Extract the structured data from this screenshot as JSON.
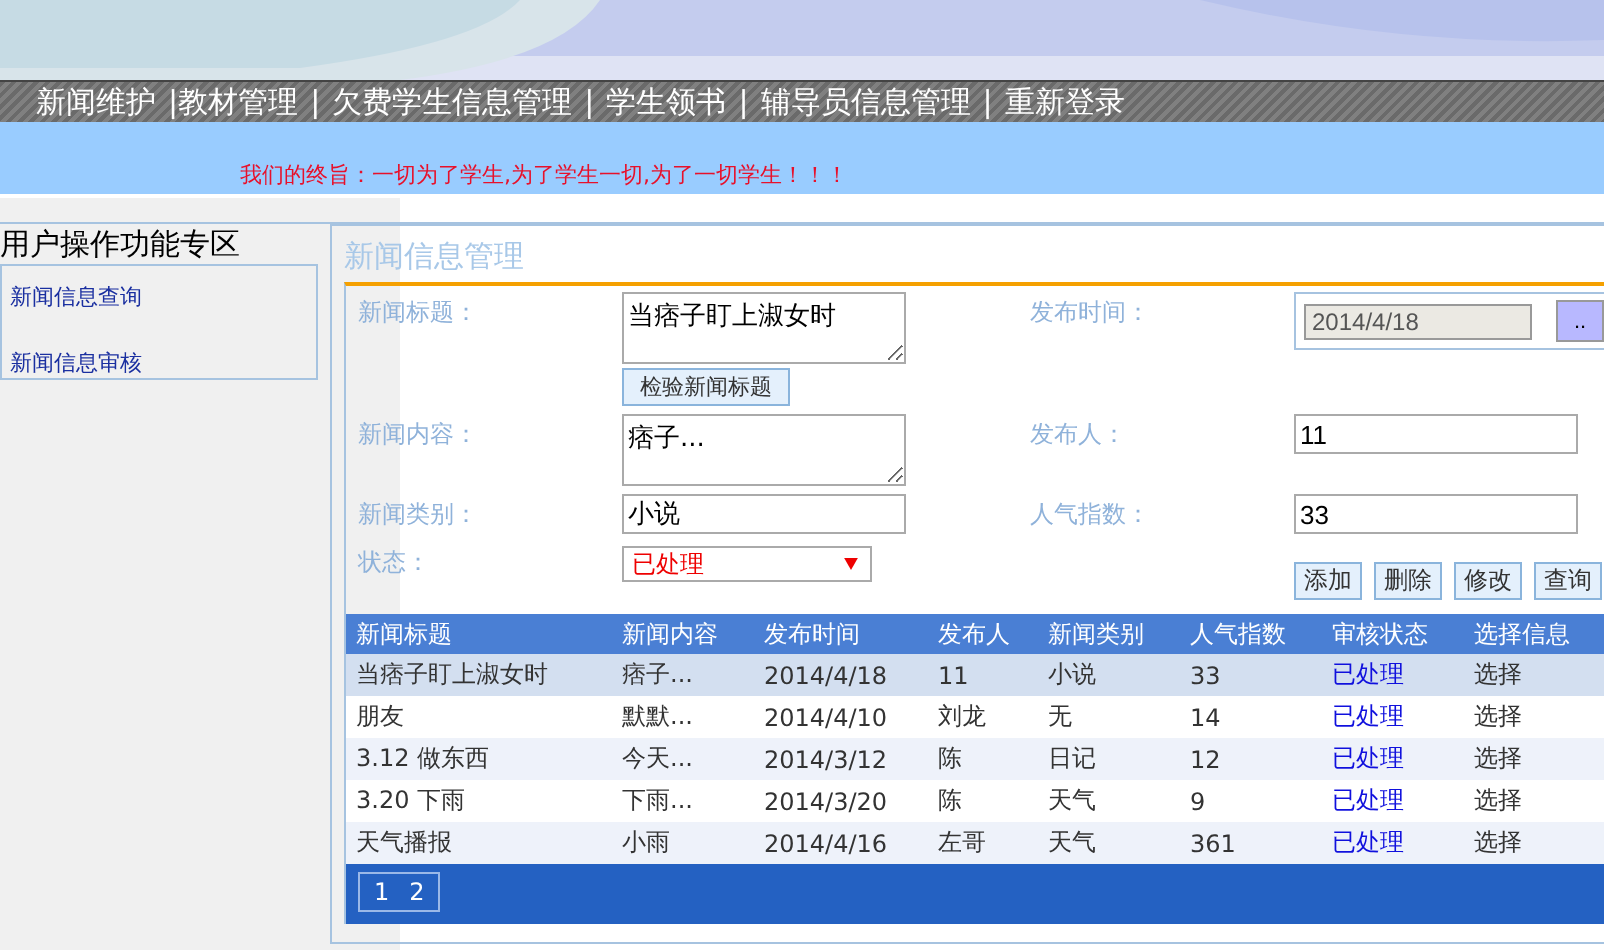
{
  "nav": [
    "新闻维护",
    "|教材管理",
    "|",
    "欠费学生信息管理",
    "|",
    "学生领书",
    "|",
    "辅导员信息管理",
    "|",
    "重新登录"
  ],
  "slogan": "我们的终旨：一切为了学生,为了学生一切,为了一切学生！！！",
  "sidebar": {
    "title": "用户操作功能专区",
    "items": [
      "新闻信息查询",
      "新闻信息审核"
    ]
  },
  "panel_title": "新闻信息管理",
  "form": {
    "title_label": "新闻标题：",
    "title_value": "当痞子盯上淑女时",
    "check_button": "检验新闻标题",
    "time_label": "发布时间：",
    "time_value": "2014/4/18",
    "time_button": "..",
    "content_label": "新闻内容：",
    "content_value": "痞子...",
    "author_label": "发布人：",
    "author_value": "11",
    "category_label": "新闻类别：",
    "category_value": "小说",
    "popularity_label": "人气指数：",
    "popularity_value": "33",
    "status_label": "状态：",
    "status_value": "已处理"
  },
  "actions": [
    "添加",
    "删除",
    "修改",
    "查询"
  ],
  "table": {
    "columns": [
      "新闻标题",
      "新闻内容",
      "发布时间",
      "发布人",
      "新闻类别",
      "人气指数",
      "审核状态",
      "选择信息"
    ],
    "rows": [
      {
        "cells": [
          "当痞子盯上淑女时",
          "痞子...",
          "2014/4/18",
          "11",
          "小说",
          "33",
          "已处理",
          "选择"
        ],
        "selected": true
      },
      {
        "cells": [
          "朋友",
          "默默...",
          "2014/4/10",
          "刘龙",
          "无",
          "14",
          "已处理",
          "选择"
        ],
        "selected": false
      },
      {
        "cells": [
          "3.12 做东西",
          "今天...",
          "2014/3/12",
          "陈",
          "日记",
          "12",
          "已处理",
          "选择"
        ],
        "selected": false
      },
      {
        "cells": [
          "3.20 下雨",
          "下雨...",
          "2014/3/20",
          "陈",
          "天气",
          "9",
          "已处理",
          "选择"
        ],
        "selected": false
      },
      {
        "cells": [
          "天气播报",
          "小雨",
          "2014/4/16",
          "左哥",
          "天气",
          "361",
          "已处理",
          "选择"
        ],
        "selected": false
      }
    ]
  },
  "pager": [
    "1",
    "2"
  ]
}
